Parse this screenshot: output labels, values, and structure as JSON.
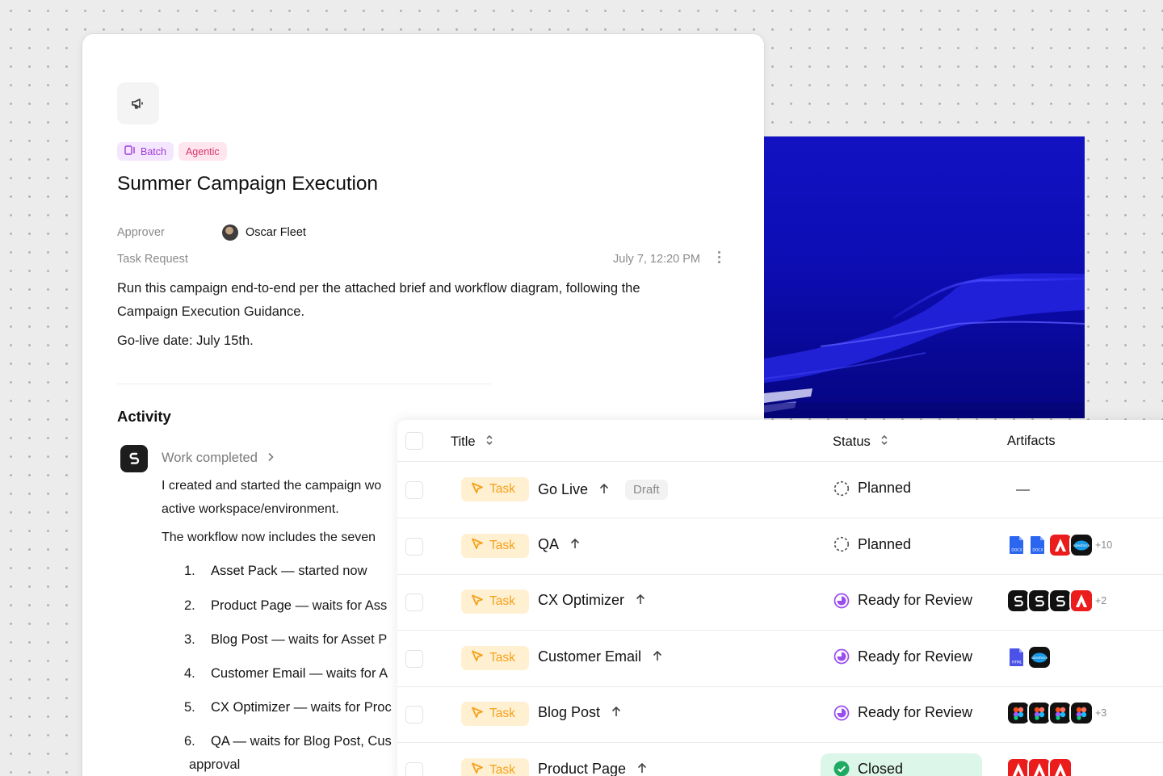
{
  "card": {
    "tags": {
      "batch": "Batch",
      "agentic": "Agentic"
    },
    "title": "Summer Campaign Execution",
    "approver_label": "Approver",
    "approver_name": "Oscar Fleet",
    "task_request_label": "Task Request",
    "task_request_date": "July 7, 12:20 PM",
    "description": "Run this campaign end-to-end per the attached brief and workflow diagram, following the Campaign Execution Guidance.",
    "golive": "Go-live date: July 15th."
  },
  "activity": {
    "heading": "Activity",
    "work_completed": "Work completed",
    "line1": "I created and started the campaign wo",
    "line2": "active workspace/environment.",
    "line3": "The workflow now includes the seven",
    "steps": [
      {
        "num": "1.",
        "name": "Asset Pack",
        "rest": " — started now"
      },
      {
        "num": "2.",
        "name": "Product Page",
        "rest": " — waits for Ass"
      },
      {
        "num": "3.",
        "name": "Blog Post",
        "rest": " — waits for Asset P"
      },
      {
        "num": "4.",
        "name": "Customer Email",
        "rest": " — waits for A"
      },
      {
        "num": "5.",
        "name": "CX Optimizer",
        "rest": " — waits for Proc"
      },
      {
        "num": "6.",
        "name": "QA",
        "rest": " — waits for Blog Post, Cus"
      }
    ],
    "step6_cont": "approval"
  },
  "table": {
    "headers": {
      "title": "Title",
      "status": "Status",
      "artifacts": "Artifacts"
    },
    "rows": [
      {
        "type": "Task",
        "title": "Go Live",
        "draft": "Draft",
        "status": "Planned",
        "status_kind": "planned",
        "artifacts": [],
        "more": ""
      },
      {
        "type": "Task",
        "title": "QA",
        "status": "Planned",
        "status_kind": "planned",
        "artifacts": [
          "docx-icon",
          "docx-icon",
          "adobe-icon",
          "salesforce-icon"
        ],
        "more": "+10"
      },
      {
        "type": "Task",
        "title": "CX Optimizer",
        "status": "Ready for Review",
        "status_kind": "review",
        "artifacts": [
          "app-icon",
          "app-icon",
          "app-icon",
          "adobe-icon"
        ],
        "more": "+2"
      },
      {
        "type": "Task",
        "title": "Customer Email",
        "status": "Ready for Review",
        "status_kind": "review",
        "artifacts": [
          "html-icon",
          "salesforce-icon"
        ],
        "more": ""
      },
      {
        "type": "Task",
        "title": "Blog Post",
        "status": "Ready for Review",
        "status_kind": "review",
        "artifacts": [
          "figma-icon",
          "figma-icon",
          "figma-icon",
          "figma-icon"
        ],
        "more": "+3"
      },
      {
        "type": "Task",
        "title": "Product Page",
        "status": "Closed",
        "status_kind": "closed",
        "artifacts": [
          "adobe-icon",
          "adobe-icon",
          "adobe-icon"
        ],
        "more": ""
      }
    ]
  },
  "colors": {
    "task_badge": "#f4a11a",
    "review": "#9b4df0",
    "closed": "#1faa62",
    "batch": "#a03ad6",
    "agentic": "#d7346c"
  }
}
